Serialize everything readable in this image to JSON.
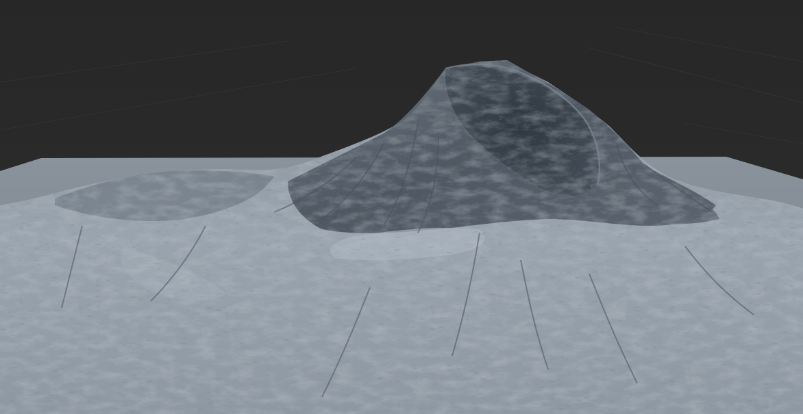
{
  "viewport": {
    "background_color": "#2b2b2b",
    "grid_line_color": "#333333",
    "plane_color": "#7d8791",
    "terrain_light_color": "#a6b0ba",
    "terrain_mid_color": "#7c8690",
    "terrain_shadow_color": "#3f4750",
    "crater_color": "#333b44",
    "render_style": "solid-shaded-terrain-mesh"
  }
}
